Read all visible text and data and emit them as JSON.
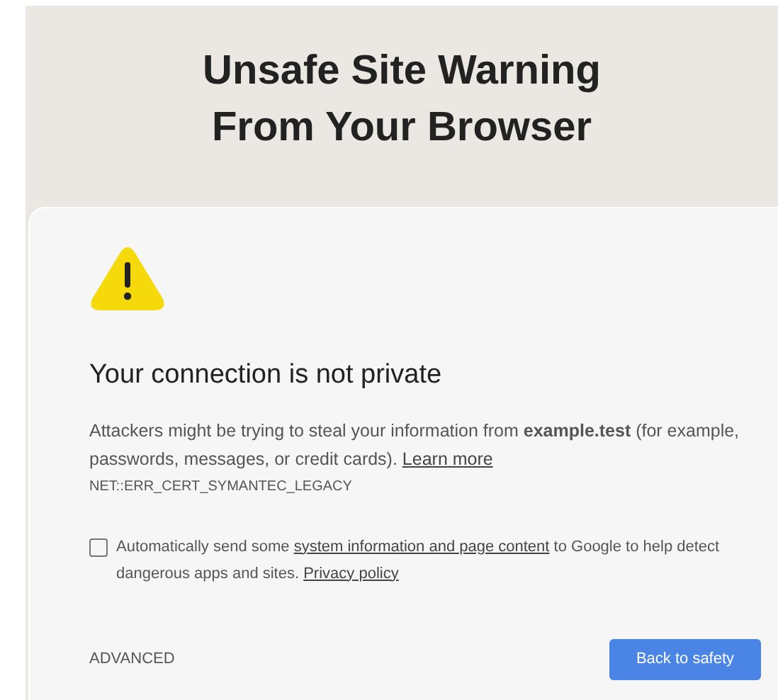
{
  "banner": {
    "title_lines": [
      "Unsafe Site Warning",
      "From Your Browser"
    ]
  },
  "warning": {
    "heading": "Your connection is not private",
    "message": [
      {
        "kind": "text",
        "text": "Attackers might be trying to steal your information from **example.test** (for example, passwords, messages, or credit cards). "
      },
      {
        "kind": "link",
        "text": "Learn more"
      }
    ],
    "error_code": "NET::ERR_CERT_SYMANTEC_LEGACY",
    "report_option": {
      "checked": false,
      "label": [
        {
          "kind": "text",
          "text": "Automatically send some "
        },
        {
          "kind": "link",
          "text": "system information and page content"
        },
        {
          "kind": "text",
          "text": " to Google to help detect dangerous apps and sites. "
        },
        {
          "kind": "link",
          "text": "Privacy policy"
        }
      ]
    },
    "advanced_button": "ADVANCED",
    "back_button": "Back to safety"
  }
}
